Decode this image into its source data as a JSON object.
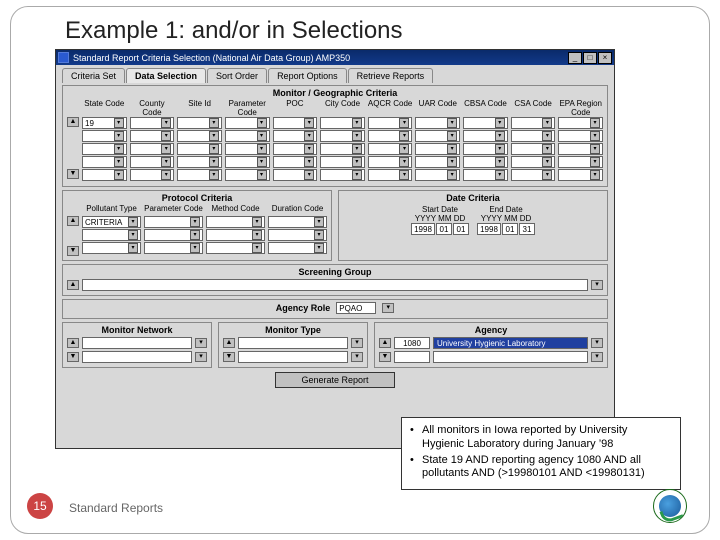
{
  "slide": {
    "title": "Example 1: and/or in Selections",
    "footer": "Standard Reports",
    "number": "15"
  },
  "window": {
    "title": "Standard Report Criteria Selection (National Air Data Group) AMP350",
    "min": "_",
    "restore": "□",
    "close": "×"
  },
  "tabs": [
    "Criteria Set",
    "Data Selection",
    "Sort Order",
    "Report Options",
    "Retrieve Reports"
  ],
  "active_tab": 1,
  "geo": {
    "title": "Monitor / Geographic Criteria",
    "headers": [
      "State Code",
      "County Code",
      "Site Id",
      "Parameter Code",
      "POC",
      "City Code",
      "AQCR Code",
      "UAR Code",
      "CBSA Code",
      "CSA Code",
      "EPA Region Code"
    ],
    "first_value": "19",
    "nav_up": "▲",
    "nav_dn": "▼",
    "dd": "▾",
    "criteria_label": "CRITERIA"
  },
  "protocol": {
    "title": "Protocol Criteria",
    "headers": [
      "Pollutant Type",
      "Parameter Code",
      "Method Code",
      "Duration Code"
    ]
  },
  "date": {
    "title": "Date Criteria",
    "start_label": "Start Date",
    "end_label": "End Date",
    "yyyy_mm_dd": "YYYY  MM  DD",
    "start": {
      "y": "1998",
      "m": "01",
      "d": "01"
    },
    "end": {
      "y": "1998",
      "m": "01",
      "d": "31"
    }
  },
  "screening": {
    "title": "Screening Group"
  },
  "monitor_network": {
    "title": "Monitor Network"
  },
  "monitor_type": {
    "title": "Monitor Type"
  },
  "agency_role": {
    "title": "Agency Role",
    "value": "PQAO"
  },
  "agency": {
    "title": "Agency",
    "code": "1080",
    "name": "University Hygienic Laboratory"
  },
  "generate_btn": "Generate Report",
  "bullets": [
    "All monitors in Iowa reported by University Hygienic Laboratory during January ’98",
    "State 19 AND reporting agency 1080 AND all pollutants AND (>19980101 AND <19980131)"
  ],
  "chart_data": {
    "type": "table",
    "title": "Criteria values entered in the form",
    "fields": [
      {
        "name": "State Code",
        "value": "19"
      },
      {
        "name": "Start Date",
        "value": "1998-01-01"
      },
      {
        "name": "End Date",
        "value": "1998-01-31"
      },
      {
        "name": "Agency Role",
        "value": "PQAO"
      },
      {
        "name": "Agency Code",
        "value": "1080"
      },
      {
        "name": "Agency Name",
        "value": "University Hygienic Laboratory"
      }
    ]
  }
}
